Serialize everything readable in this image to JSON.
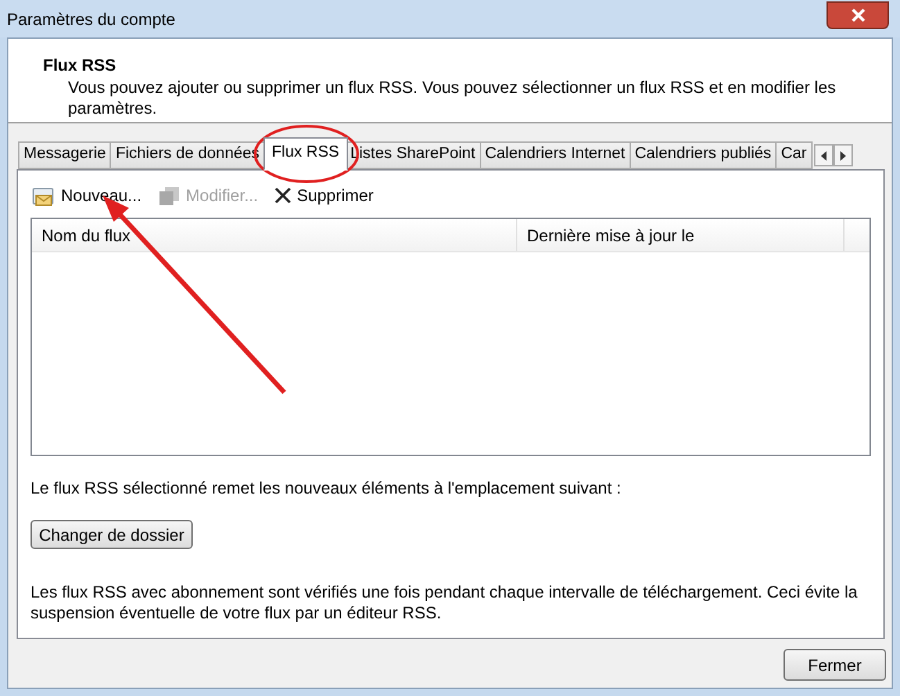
{
  "window": {
    "title": "Paramètres du compte"
  },
  "header": {
    "title": "Flux RSS",
    "description": "Vous pouvez ajouter ou supprimer un flux RSS. Vous pouvez sélectionner un flux RSS et en modifier les paramètres."
  },
  "tabs": [
    {
      "label": "Messagerie",
      "selected": false
    },
    {
      "label": "Fichiers de données",
      "selected": false
    },
    {
      "label": "Flux RSS",
      "selected": true
    },
    {
      "label": "Listes SharePoint",
      "selected": false
    },
    {
      "label": "Calendriers Internet",
      "selected": false
    },
    {
      "label": "Calendriers publiés",
      "selected": false
    },
    {
      "label": "Car",
      "selected": false
    }
  ],
  "toolbar": [
    {
      "kind": "new",
      "label": "Nouveau...",
      "disabled": false
    },
    {
      "kind": "edit",
      "label": "Modifier...",
      "disabled": true
    },
    {
      "kind": "delete",
      "label": "Supprimer",
      "disabled": false
    }
  ],
  "table": {
    "columns": [
      "Nom du flux",
      "Dernière mise à jour le"
    ]
  },
  "location_text": "Le flux RSS sélectionné remet les nouveaux éléments à l'emplacement suivant :",
  "change_folder_button": "Changer de dossier",
  "info_text": "Les flux RSS avec abonnement sont vérifiés une fois pendant chaque intervalle de téléchargement. Ceci évite la suspension éventuelle de votre flux par un éditeur RSS.",
  "close_button": "Fermer"
}
